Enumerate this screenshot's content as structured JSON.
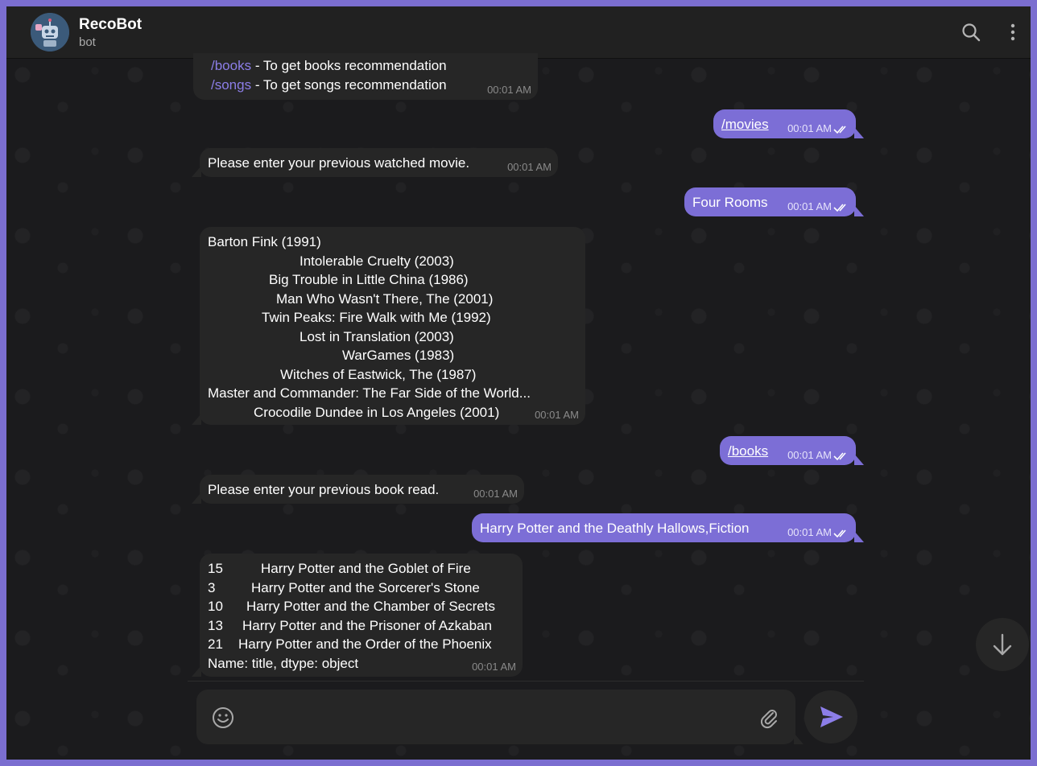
{
  "header": {
    "title": "RecoBot",
    "subtitle": "bot"
  },
  "messages": {
    "m0": {
      "line1_cmd": "/books",
      "line1_text": " - To get books recommendation",
      "line2_cmd": "/songs",
      "line2_text": " - To get songs recommendation",
      "time": "00:01 AM"
    },
    "m1": {
      "text": "/movies",
      "time": "00:01 AM"
    },
    "m2": {
      "text": "Please enter your previous watched movie.",
      "time": "00:01 AM"
    },
    "m3": {
      "text": "Four Rooms",
      "time": "00:01 AM"
    },
    "m4": {
      "lines": [
        "Barton Fink (1991)",
        "Intolerable Cruelty (2003)",
        "Big Trouble in Little China (1986)",
        "Man Who Wasn't There, The (2001)",
        "Twin Peaks: Fire Walk with Me (1992)",
        "Lost in Translation (2003)",
        "WarGames (1983)",
        "Witches of Eastwick, The (1987)",
        "Master and Commander: The Far Side of the World...",
        "Crocodile Dundee in Los Angeles (2001)"
      ],
      "time": "00:01 AM"
    },
    "m5": {
      "text": "/books",
      "time": "00:01 AM"
    },
    "m6": {
      "text": "Please enter your previous book read.",
      "time": "00:01 AM"
    },
    "m7": {
      "text": "Harry Potter and the Deathly Hallows,Fiction",
      "time": "00:01 AM"
    },
    "m8": {
      "rows": [
        {
          "idx": "15",
          "title": "Harry Potter and the Goblet of Fire"
        },
        {
          "idx": "3",
          "title": "Harry Potter and the Sorcerer's Stone"
        },
        {
          "idx": "10",
          "title": "Harry Potter and the Chamber of Secrets"
        },
        {
          "idx": "13",
          "title": "Harry Potter and the Prisoner of Azkaban"
        },
        {
          "idx": "21",
          "title": "Harry Potter and the Order of the Phoenix"
        }
      ],
      "footer": "Name: title, dtype: object",
      "time": "00:01 AM"
    }
  },
  "composer": {
    "placeholder": "",
    "value": ""
  },
  "colors": {
    "accent": "#7c6ed6",
    "frame": "#7b6ed0",
    "incoming_bubble": "#262626",
    "background": "#1b1b1d"
  },
  "icons": {
    "search": "search-icon",
    "menu": "more-vertical-icon",
    "emoji": "smiley-icon",
    "attach": "paperclip-icon",
    "send": "send-icon",
    "scroll_down": "arrow-down-icon",
    "read_status": "double-check-icon"
  }
}
